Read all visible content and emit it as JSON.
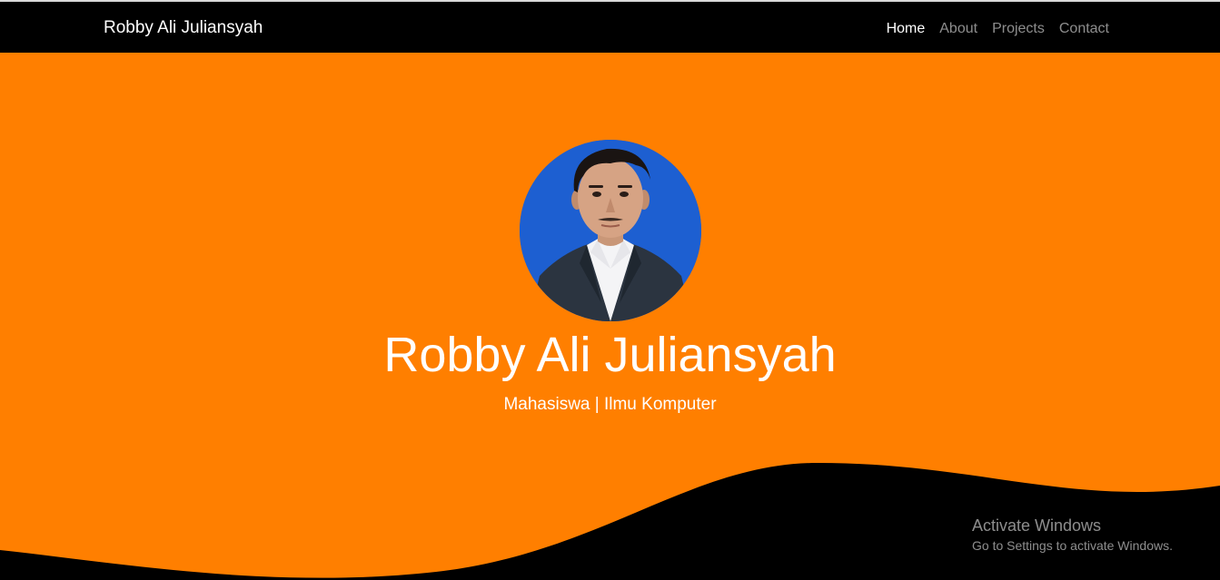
{
  "navbar": {
    "brand": "Robby Ali Juliansyah",
    "links": [
      {
        "label": "Home",
        "active": true
      },
      {
        "label": "About",
        "active": false
      },
      {
        "label": "Projects",
        "active": false
      },
      {
        "label": "Contact",
        "active": false
      }
    ]
  },
  "hero": {
    "name": "Robby Ali Juliansyah",
    "subtitle": "Mahasiswa | Ilmu Komputer",
    "avatar_icon": "profile-photo"
  },
  "watermark": {
    "title": "Activate Windows",
    "subtitle": "Go to Settings to activate Windows."
  },
  "colors": {
    "hero_background": "#ff7f00",
    "navbar_background": "#000000",
    "wave": "#000000",
    "avatar_background": "#1d5fd1"
  }
}
